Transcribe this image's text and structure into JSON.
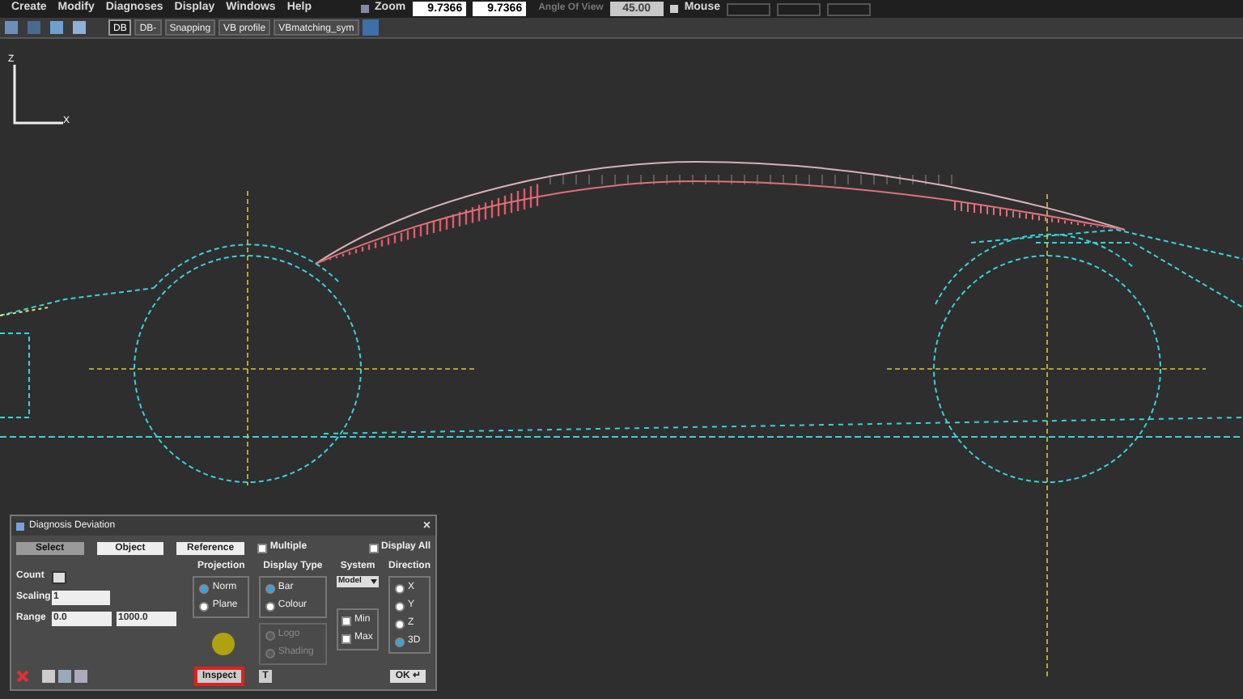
{
  "menu": [
    "Create",
    "Modify",
    "Diagnoses",
    "Display",
    "Windows",
    "Help"
  ],
  "view_bar": {
    "zoom_label": "Zoom",
    "zoom_values": [
      "9.7366",
      "9.7366"
    ],
    "angle_label": "Angle Of View",
    "angle_value": "45.00",
    "mouse_label": "Mouse"
  },
  "tabs": [
    {
      "label": "DB",
      "selected": true
    },
    {
      "label": "DB-",
      "selected": false
    },
    {
      "label": "Snapping",
      "selected": false
    },
    {
      "label": "VB profile",
      "selected": false
    },
    {
      "label": "VBmatching_sym",
      "selected": false
    }
  ],
  "axes": {
    "vertical": "Z",
    "horizontal": "X"
  },
  "dialog": {
    "title": "Diagnosis Deviation",
    "close": "×",
    "top_buttons": [
      {
        "label": "Select",
        "selected": true
      },
      {
        "label": "Object",
        "selected": false
      },
      {
        "label": "Reference",
        "selected": false
      }
    ],
    "top_checks": [
      {
        "label": "Multiple",
        "checked": false
      },
      {
        "label": "Display All",
        "checked": false
      }
    ],
    "count_label": "Count",
    "scaling_label": "Scaling",
    "scaling_value": "1",
    "range_label": "Range",
    "range_values": [
      "0.0",
      "1000.0"
    ],
    "projection": {
      "title": "Projection",
      "options": [
        {
          "label": "Norm",
          "selected": true
        },
        {
          "label": "Plane",
          "selected": false
        }
      ]
    },
    "display_type": {
      "title": "Display Type",
      "options": [
        {
          "label": "Bar",
          "selected": true
        },
        {
          "label": "Colour",
          "selected": false
        }
      ],
      "sub_options": [
        {
          "label": "Logo",
          "disabled": true
        },
        {
          "label": "Shading",
          "disabled": true
        }
      ]
    },
    "system": {
      "title": "System",
      "value": "Model",
      "checks": [
        {
          "label": "Min",
          "checked": false
        },
        {
          "label": "Max",
          "checked": false
        }
      ]
    },
    "direction": {
      "title": "Direction",
      "options": [
        {
          "label": "X",
          "selected": false
        },
        {
          "label": "Y",
          "selected": false
        },
        {
          "label": "Z",
          "selected": false
        },
        {
          "label": "3D",
          "selected": true
        }
      ]
    },
    "inspect": "Inspect",
    "text_button": "T",
    "ok": "OK ↵"
  }
}
